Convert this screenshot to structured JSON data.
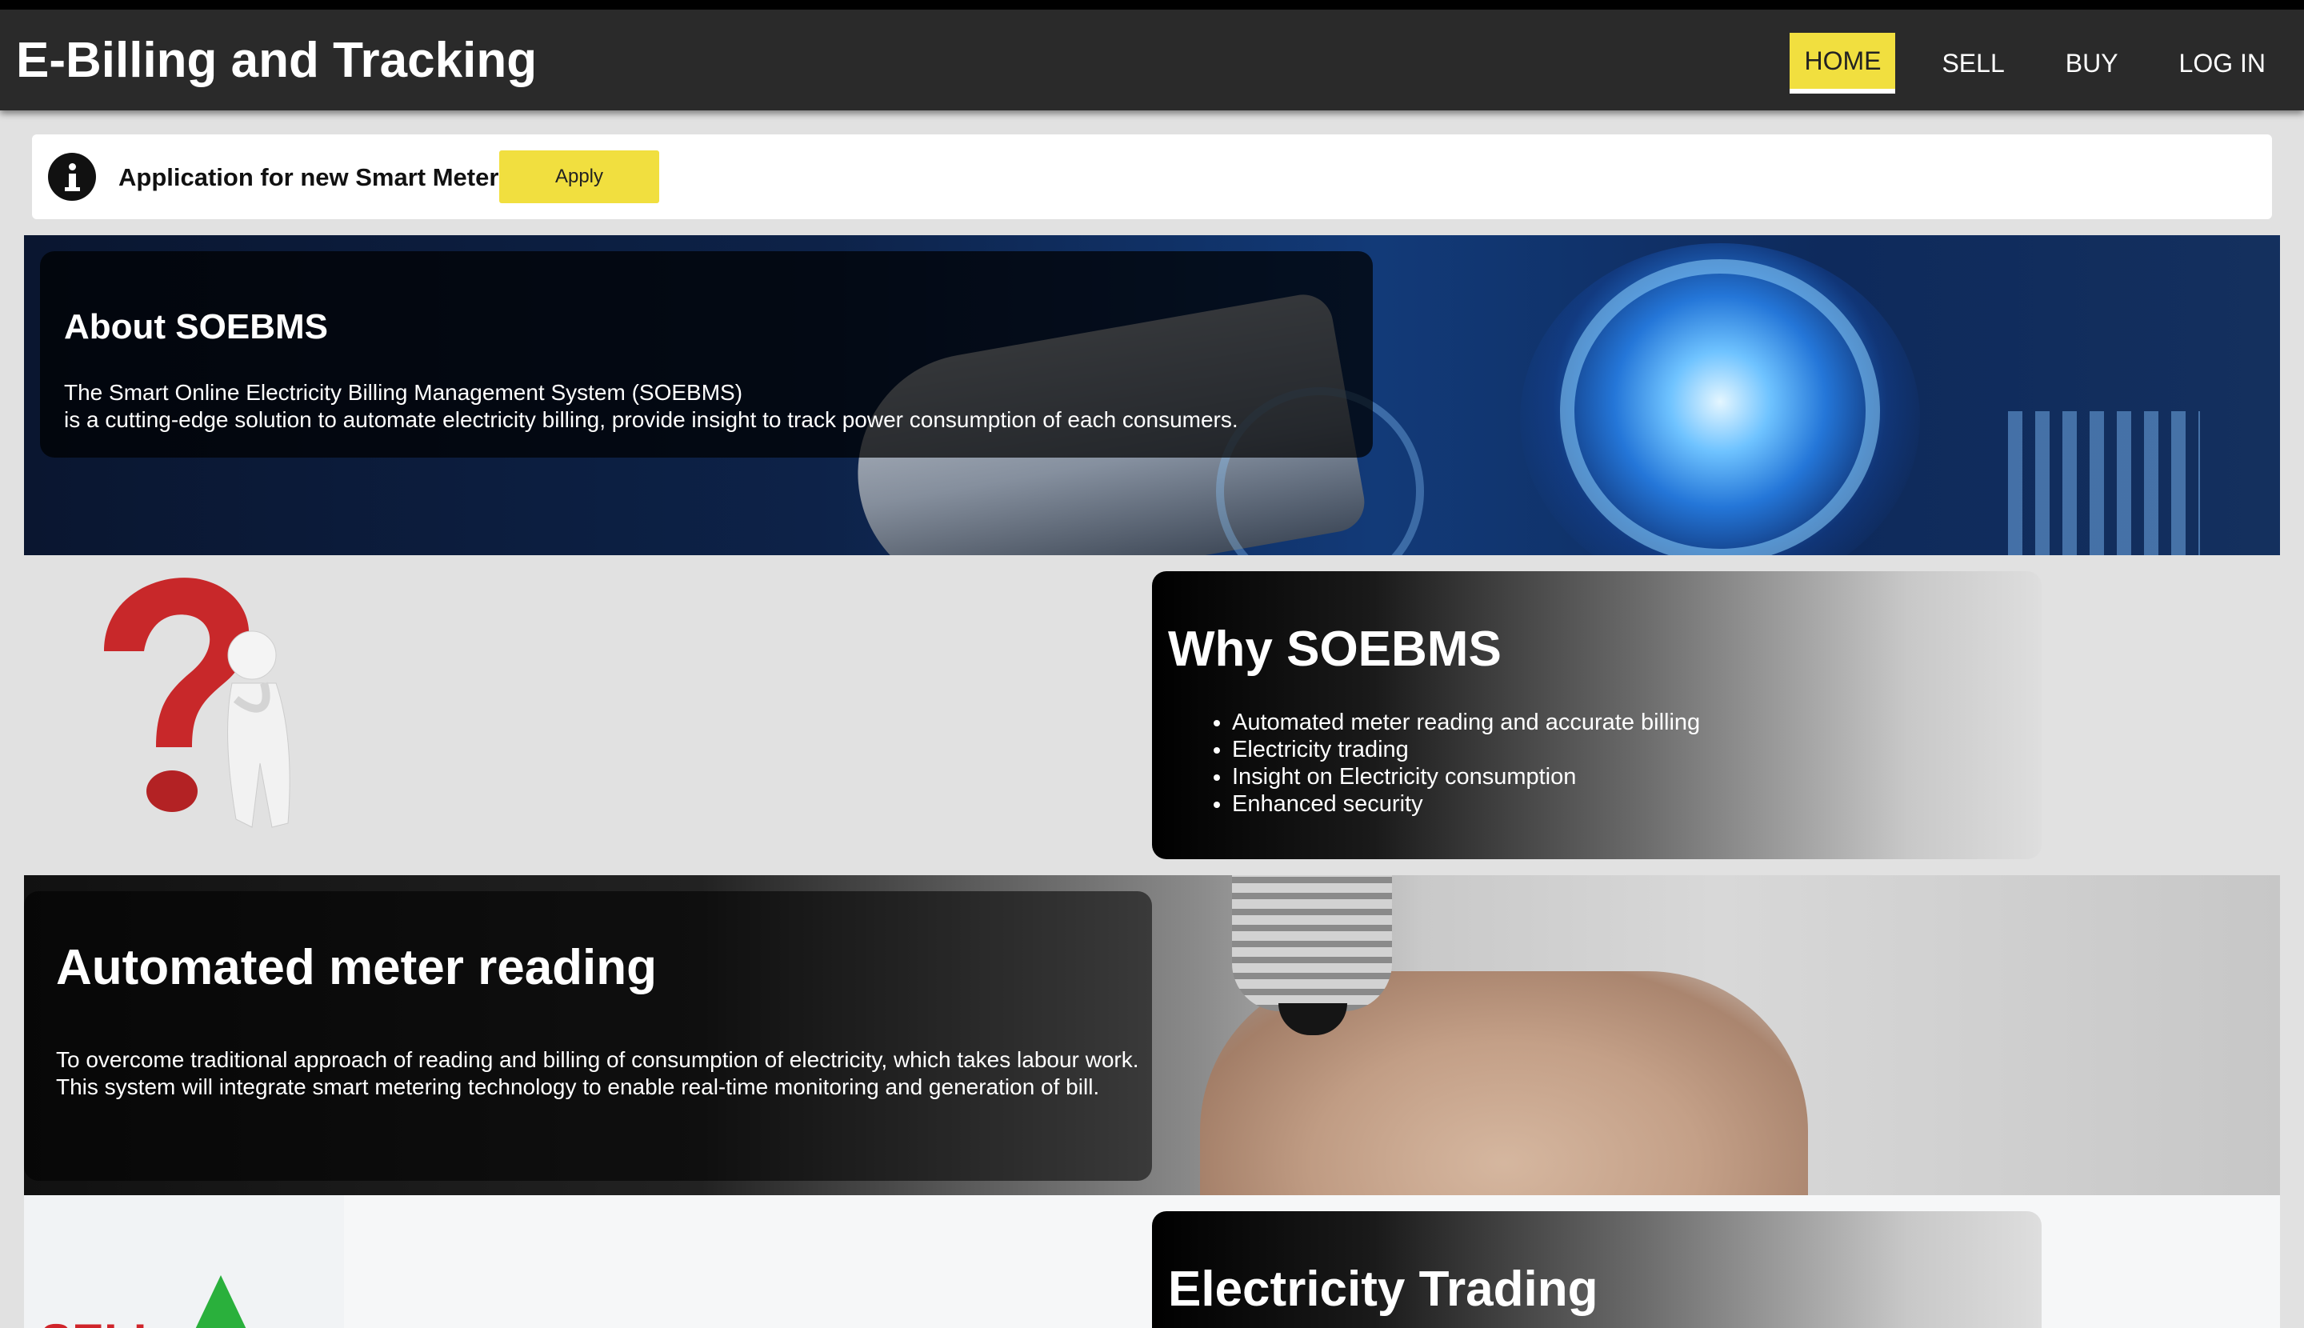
{
  "header": {
    "brand": "E-Billing and Tracking",
    "nav": [
      {
        "label": "HOME",
        "active": true
      },
      {
        "label": "SELL",
        "active": false
      },
      {
        "label": "BUY",
        "active": false
      },
      {
        "label": "LOG IN",
        "active": false
      }
    ]
  },
  "notice": {
    "icon": "info-icon",
    "text": "Application for new Smart Meter",
    "button_label": "Apply"
  },
  "about": {
    "title": "About SOEBMS",
    "line1": "The Smart Online Electricity Billing Management System (SOEBMS)",
    "line2": "is a cutting-edge solution to automate electricity billing, provide insight to track power consumption of each consumers."
  },
  "why": {
    "title": "Why SOEBMS",
    "items": [
      "Automated meter reading and accurate billing",
      "Electricity trading",
      "Insight on Electricity consumption",
      "Enhanced security"
    ]
  },
  "meter": {
    "title": "Automated meter reading",
    "body": "To overcome traditional approach of reading and billing of consumption of electricity, which takes labour work. This system will integrate smart metering technology to enable real-time monitoring and generation of bill."
  },
  "trading": {
    "title": "Electricity Trading",
    "graphic_word": "SELL"
  },
  "colors": {
    "nav_bg": "#2a2a2a",
    "accent_yellow": "#f1df3f",
    "page_bg": "#e1e1e1"
  }
}
